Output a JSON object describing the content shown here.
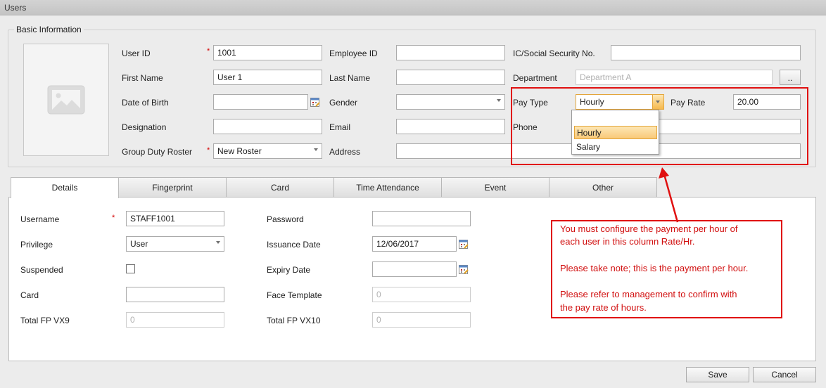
{
  "window": {
    "title": "Users"
  },
  "basic_info": {
    "legend": "Basic Information",
    "user_id_label": "User ID",
    "user_id_value": "1001",
    "first_name_label": "First Name",
    "first_name_value": "User 1",
    "dob_label": "Date of Birth",
    "dob_value": "",
    "designation_label": "Designation",
    "designation_value": "",
    "group_duty_roster_label": "Group Duty Roster",
    "group_duty_roster_value": "New Roster",
    "employee_id_label": "Employee ID",
    "employee_id_value": "",
    "last_name_label": "Last Name",
    "last_name_value": "",
    "gender_label": "Gender",
    "gender_value": "",
    "email_label": "Email",
    "email_value": "",
    "address_label": "Address",
    "address_value": "",
    "ic_label": "IC/Social Security No.",
    "ic_value": "",
    "department_label": "Department",
    "department_placeholder": "Department A",
    "department_browse_label": "..",
    "pay_type_label": "Pay Type",
    "pay_type_value": "Hourly",
    "pay_rate_label": "Pay Rate",
    "pay_rate_value": "20.00",
    "phone_label": "Phone",
    "phone_value": "",
    "pay_type_options": [
      "Hourly",
      "Salary"
    ],
    "required_mark": "*"
  },
  "tabs": [
    {
      "label": "Details"
    },
    {
      "label": "Fingerprint"
    },
    {
      "label": "Card"
    },
    {
      "label": "Time Attendance"
    },
    {
      "label": "Event"
    },
    {
      "label": "Other"
    }
  ],
  "details": {
    "username_label": "Username",
    "username_value": "STAFF1001",
    "privilege_label": "Privilege",
    "privilege_value": "User",
    "suspended_label": "Suspended",
    "card_label": "Card",
    "card_value": "",
    "total_fp_vx9_label": "Total FP VX9",
    "total_fp_vx9_value": "0",
    "password_label": "Password",
    "password_value": "",
    "issuance_date_label": "Issuance Date",
    "issuance_date_value": "12/06/2017",
    "expiry_date_label": "Expiry Date",
    "expiry_date_value": "",
    "face_template_label": "Face Template",
    "face_template_value": "0",
    "total_fp_vx10_label": "Total FP VX10",
    "total_fp_vx10_value": "0"
  },
  "annotation": {
    "line1": "You must configure the payment per hour of",
    "line2": "each user in this column Rate/Hr.",
    "line3": "Please take note; this is the payment per hour.",
    "line4": "Please refer to management to confirm with",
    "line5": "the pay rate of hours.",
    "color": "#e01010"
  },
  "buttons": {
    "save": "Save",
    "cancel": "Cancel"
  }
}
